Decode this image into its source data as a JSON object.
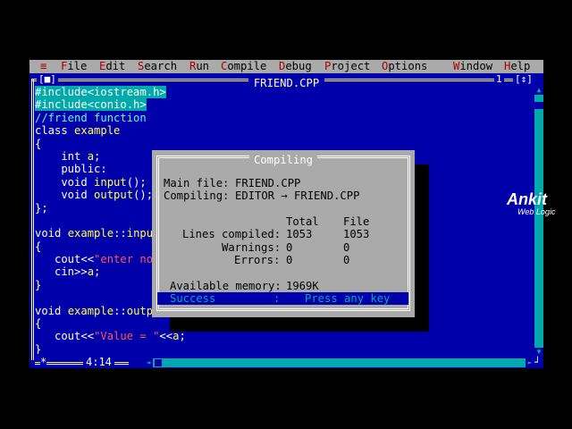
{
  "menu": {
    "system": "≡",
    "items": [
      {
        "hot": "F",
        "rest": "ile"
      },
      {
        "hot": "E",
        "rest": "dit"
      },
      {
        "hot": "S",
        "rest": "earch"
      },
      {
        "hot": "R",
        "rest": "un"
      },
      {
        "hot": "C",
        "rest": "ompile"
      },
      {
        "hot": "D",
        "rest": "ebug"
      },
      {
        "hot": "P",
        "rest": "roject"
      },
      {
        "hot": "O",
        "rest": "ptions"
      },
      {
        "hot": "W",
        "rest": "indow"
      },
      {
        "hot": "H",
        "rest": "elp"
      }
    ]
  },
  "editor": {
    "close_box": "[■]",
    "title": "FRIEND.CPP",
    "window_number": "1",
    "zoom_box": "[↕]",
    "status_marker": "*",
    "cursor_position": "4:14",
    "code_lines": [
      [
        {
          "t": "#include<iostream.h>",
          "k": "pp"
        }
      ],
      [
        {
          "t": "#include<conio.h>",
          "k": "pp"
        }
      ],
      [
        {
          "t": "//friend function",
          "k": "cm"
        }
      ],
      [
        {
          "t": "class ",
          "k": "kw"
        },
        {
          "t": "example",
          "k": "id"
        }
      ],
      [
        {
          "t": "{",
          "k": "plain"
        }
      ],
      [
        {
          "t": "    int ",
          "k": "kw"
        },
        {
          "t": "a",
          "k": "id"
        },
        {
          "t": ";",
          "k": "plain"
        }
      ],
      [
        {
          "t": "    public:",
          "k": "kw"
        }
      ],
      [
        {
          "t": "    void ",
          "k": "kw"
        },
        {
          "t": "input",
          "k": "id"
        },
        {
          "t": "();",
          "k": "plain"
        }
      ],
      [
        {
          "t": "    void ",
          "k": "kw"
        },
        {
          "t": "output",
          "k": "id"
        },
        {
          "t": "();",
          "k": "plain"
        }
      ],
      [
        {
          "t": "};",
          "k": "plain"
        }
      ],
      [
        {
          "t": "",
          "k": "plain"
        }
      ],
      [
        {
          "t": "void ",
          "k": "kw"
        },
        {
          "t": "example",
          "k": "id"
        },
        {
          "t": "::",
          "k": "plain"
        },
        {
          "t": "input",
          "k": "id"
        }
      ],
      [
        {
          "t": "{",
          "k": "plain"
        }
      ],
      [
        {
          "t": "   cout<<",
          "k": "plain"
        },
        {
          "t": "\"enter no",
          "k": "str"
        }
      ],
      [
        {
          "t": "   cin>>",
          "k": "plain"
        },
        {
          "t": "a",
          "k": "id"
        },
        {
          "t": ";",
          "k": "plain"
        }
      ],
      [
        {
          "t": "}",
          "k": "plain"
        }
      ],
      [
        {
          "t": "",
          "k": "plain"
        }
      ],
      [
        {
          "t": "void ",
          "k": "kw"
        },
        {
          "t": "example",
          "k": "id"
        },
        {
          "t": "::",
          "k": "plain"
        },
        {
          "t": "outp",
          "k": "id"
        }
      ],
      [
        {
          "t": "{",
          "k": "plain"
        }
      ],
      [
        {
          "t": "   cout<<",
          "k": "plain"
        },
        {
          "t": "\"Value = \"",
          "k": "str"
        },
        {
          "t": "<<",
          "k": "plain"
        },
        {
          "t": "a",
          "k": "id"
        },
        {
          "t": ";",
          "k": "plain"
        }
      ],
      [
        {
          "t": "}",
          "k": "plain"
        }
      ]
    ]
  },
  "dialog": {
    "title": "Compiling",
    "main_file_label": "Main file:",
    "main_file_value": "FRIEND.CPP",
    "compiling_label": "Compiling:",
    "compiling_value": "EDITOR → FRIEND.CPP",
    "col_total": "Total",
    "col_file": "File",
    "lines_label": "Lines compiled:",
    "lines_total": "1053",
    "lines_file": "1053",
    "warnings_label": "Warnings:",
    "warnings_total": "0",
    "warnings_file": "0",
    "errors_label": "Errors:",
    "errors_total": "0",
    "errors_file": "0",
    "memory_label": "Available memory:",
    "memory_value": "1969K",
    "status": "Success",
    "status_sep": ":",
    "status_prompt": "Press any key"
  },
  "watermark": {
    "brand": "Ankit",
    "tagline": "Web Logic"
  },
  "colors": {
    "editor_bg": "#0000aa",
    "menu_bg": "#aaaaaa",
    "hotkey": "#aa0000",
    "identifier": "#ffff55",
    "string": "#ff5555",
    "comment": "#55ffff",
    "scrollbar": "#00aaaa"
  },
  "icons": {
    "system_menu": "system-menu-icon",
    "close": "close-box-icon",
    "zoom": "zoom-box-icon"
  }
}
